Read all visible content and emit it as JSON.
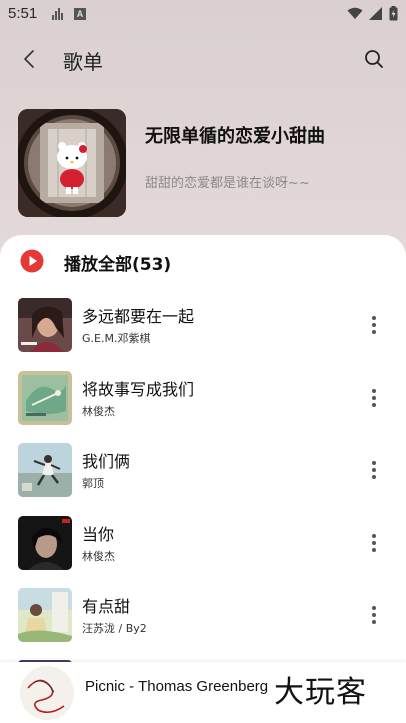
{
  "status_bar": {
    "time": "5:51",
    "a_badge": "A"
  },
  "header": {
    "title": "歌单"
  },
  "playlist": {
    "name": "无限单循的恋爱小甜曲",
    "description": "甜甜的恋爱都是谁在谈呀~~"
  },
  "play_all": {
    "label": "播放全部(53)",
    "accent": "#e53935"
  },
  "songs": [
    {
      "title": "多远都要在一起",
      "artist": "G.E.M.邓紫棋"
    },
    {
      "title": "将故事写成我们",
      "artist": "林俊杰"
    },
    {
      "title": "我们俩",
      "artist": "郭顶"
    },
    {
      "title": "当你",
      "artist": "林俊杰"
    },
    {
      "title": "有点甜",
      "artist": "汪苏泷 / By2"
    }
  ],
  "mini_player": {
    "title": "Picnic - Thomas Greenberg"
  },
  "watermark": "大玩客",
  "icons": [
    "back-icon",
    "search-icon",
    "play-circle-icon",
    "more-vert-icon",
    "wifi-icon",
    "signal-icon",
    "battery-icon"
  ]
}
